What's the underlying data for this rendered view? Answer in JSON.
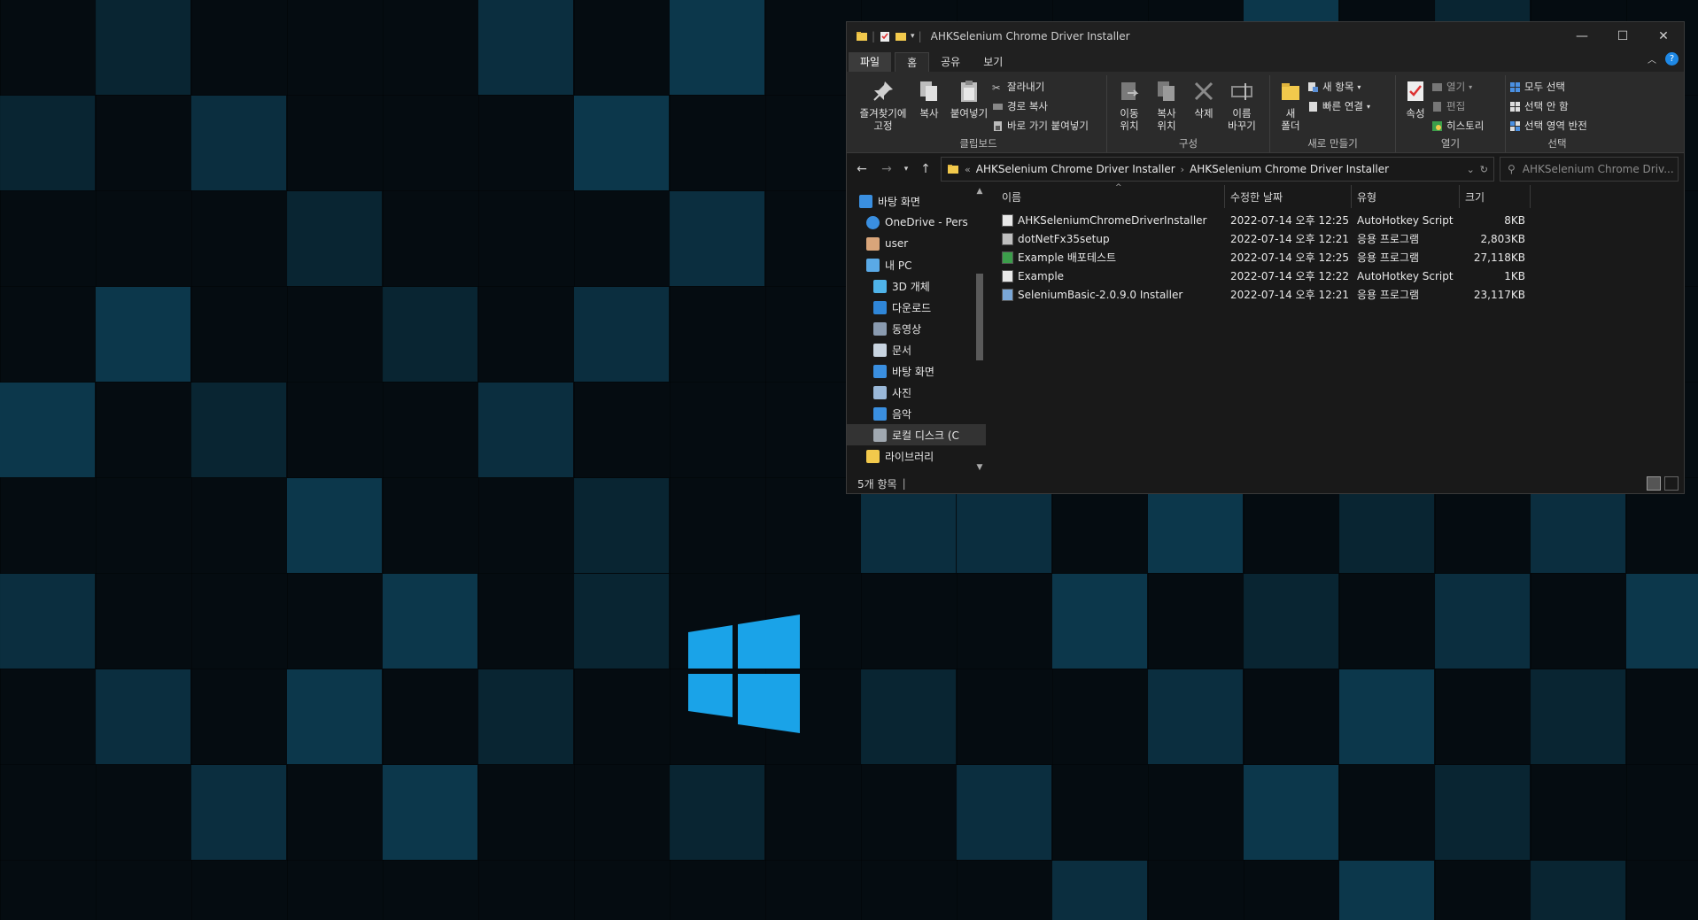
{
  "colors": {
    "accent": "#1e88e5",
    "window_bg": "#191919",
    "ribbon_bg": "#2b2b2b",
    "desktop_tile": "#0d3a4f",
    "windows_logo": "#1aa3e8"
  },
  "window": {
    "title": "AHKSelenium Chrome Driver Installer",
    "controls": {
      "minimize": "—",
      "maximize": "☐",
      "close": "✕"
    }
  },
  "tabs": [
    {
      "label": "파일"
    },
    {
      "label": "홈"
    },
    {
      "label": "공유"
    },
    {
      "label": "보기"
    }
  ],
  "ribbon": {
    "clipboard": {
      "label": "클립보드",
      "pin": "즐겨찾기에\n고정",
      "copy": "복사",
      "paste": "붙여넣기",
      "cut": "잘라내기",
      "copy_path": "경로 복사",
      "paste_shortcut": "바로 가기 붙여넣기"
    },
    "organize": {
      "label": "구성",
      "move_to": "이동\n위치",
      "copy_to": "복사\n위치",
      "delete": "삭제",
      "rename": "이름\n바꾸기"
    },
    "new": {
      "label": "새로 만들기",
      "new_folder": "새\n폴더",
      "new_item": "새 항목",
      "easy_access": "빠른 연결"
    },
    "open": {
      "label": "열기",
      "properties": "속성",
      "open": "열기",
      "edit": "편집",
      "history": "히스토리"
    },
    "select": {
      "label": "선택",
      "select_all": "모두 선택",
      "select_none": "선택 안 함",
      "invert": "선택 영역 반전"
    }
  },
  "address": {
    "crumbs": [
      "AHKSelenium Chrome Driver Installer",
      "AHKSelenium Chrome Driver Installer"
    ],
    "search_placeholder": "AHKSelenium Chrome Driv..."
  },
  "nav": [
    {
      "label": "바탕 화면",
      "indent": 1,
      "icon": "desktop-icon"
    },
    {
      "label": "OneDrive - Pers",
      "indent": 2,
      "icon": "onedrive-icon"
    },
    {
      "label": "user",
      "indent": 2,
      "icon": "user-icon"
    },
    {
      "label": "내 PC",
      "indent": 2,
      "icon": "pc-icon"
    },
    {
      "label": "3D 개체",
      "indent": 3,
      "icon": "cube-icon"
    },
    {
      "label": "다운로드",
      "indent": 3,
      "icon": "download-icon"
    },
    {
      "label": "동영상",
      "indent": 3,
      "icon": "video-icon"
    },
    {
      "label": "문서",
      "indent": 3,
      "icon": "document-icon"
    },
    {
      "label": "바탕 화면",
      "indent": 3,
      "icon": "desktop-icon"
    },
    {
      "label": "사진",
      "indent": 3,
      "icon": "picture-icon"
    },
    {
      "label": "음악",
      "indent": 3,
      "icon": "music-icon"
    },
    {
      "label": "로컬 디스크 (C",
      "indent": 3,
      "icon": "disk-icon",
      "selected": true
    },
    {
      "label": "라이브러리",
      "indent": 2,
      "icon": "library-icon"
    }
  ],
  "columns": {
    "name": "이름",
    "modified": "수정한 날짜",
    "type": "유형",
    "size": "크기"
  },
  "files": [
    {
      "name": "AHKSeleniumChromeDriverInstaller",
      "modified": "2022-07-14 오후 12:25",
      "type": "AutoHotkey Script",
      "size": "8KB",
      "icon": "ahk-script-icon"
    },
    {
      "name": "dotNetFx35setup",
      "modified": "2022-07-14 오후 12:21",
      "type": "응용 프로그램",
      "size": "2,803KB",
      "icon": "setup-exe-icon"
    },
    {
      "name": "Example 배포테스트",
      "modified": "2022-07-14 오후 12:25",
      "type": "응용 프로그램",
      "size": "27,118KB",
      "icon": "ahk-exe-icon"
    },
    {
      "name": "Example",
      "modified": "2022-07-14 오후 12:22",
      "type": "AutoHotkey Script",
      "size": "1KB",
      "icon": "ahk-script-icon"
    },
    {
      "name": "SeleniumBasic-2.0.9.0 Installer",
      "modified": "2022-07-14 오후 12:21",
      "type": "응용 프로그램",
      "size": "23,117KB",
      "icon": "installer-icon"
    }
  ],
  "status": {
    "item_count": "5개 항목"
  }
}
